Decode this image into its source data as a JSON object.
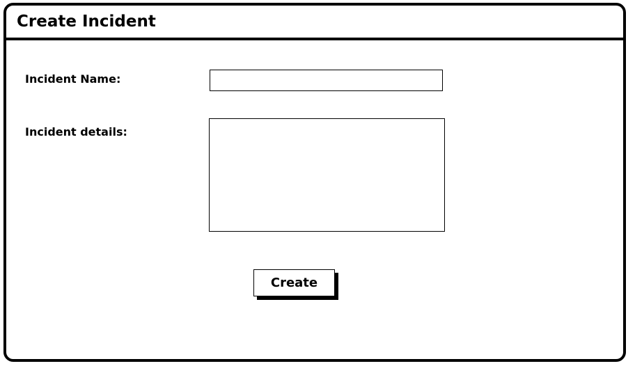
{
  "window": {
    "title": "Create Incident"
  },
  "form": {
    "incident_name": {
      "label": "Incident Name:",
      "value": ""
    },
    "incident_details": {
      "label": "Incident details:",
      "value": ""
    },
    "create_button_label": "Create"
  }
}
